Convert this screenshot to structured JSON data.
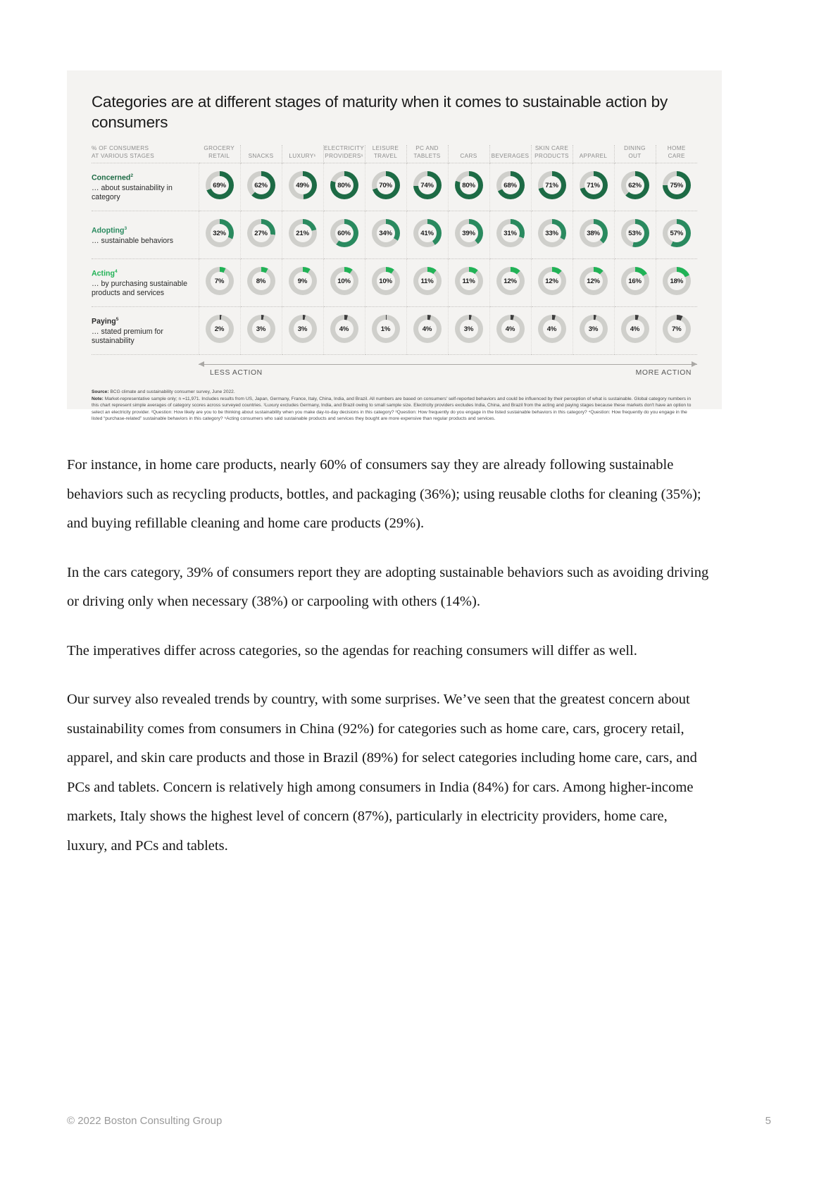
{
  "exhibit": {
    "title": "Categories are at different stages of maturity when it comes to sustainable action by consumers",
    "corner_header_line1": "% OF CONSUMERS",
    "corner_header_line2": "AT VARIOUS STAGES",
    "axis_left": "LESS ACTION",
    "axis_right": "MORE ACTION",
    "source_label": "Source:",
    "source_text": "BCG climate and sustainability consumer survey, June 2022.",
    "note_label": "Note:",
    "note_text": "Market-representative sample only; n =11,971. Includes results from US, Japan, Germany, France, Italy, China, India, and Brazil. All numbers are based on consumers' self-reported behaviors and could be influenced by their perception of what is sustainable. Global category numbers in this chart represent simple averages of category scores across surveyed countries. ¹Luxury excludes Germany, India, and Brazil owing to small sample size. Electricity providers excludes India, China, and Brazil from the acting and paying stages because these markets don't have an option to select an electricity provider. ²Question: How likely are you to be thinking about sustainability when you make day-to-day decisions in this category? ³Question: How frequently do you engage in the listed sustainable behaviors in this category? ⁴Question: How frequently do you engage in the listed “purchase-related” sustainable behaviors in this category? ⁵Acting consumers who said sustainable products and services they bought are more expensive than regular products and services."
  },
  "chart_data": {
    "type": "heatmap",
    "title": "Categories are at different stages of maturity when it comes to sustainable action by consumers",
    "unit": "%",
    "categories": [
      {
        "line1": "GROCERY",
        "line2": "RETAIL"
      },
      {
        "line1": "",
        "line2": "SNACKS"
      },
      {
        "line1": "",
        "line2": "LUXURY¹"
      },
      {
        "line1": "ELECTRICITY",
        "line2": "PROVIDERS¹"
      },
      {
        "line1": "LEISURE",
        "line2": "TRAVEL"
      },
      {
        "line1": "PC AND",
        "line2": "TABLETS"
      },
      {
        "line1": "",
        "line2": "CARS"
      },
      {
        "line1": "",
        "line2": "BEVERAGES"
      },
      {
        "line1": "SKIN CARE",
        "line2": "PRODUCTS"
      },
      {
        "line1": "",
        "line2": "APPAREL"
      },
      {
        "line1": "DINING",
        "line2": "OUT"
      },
      {
        "line1": "HOME",
        "line2": "CARE"
      }
    ],
    "series": [
      {
        "name": "Concerned",
        "sup": "2",
        "desc": "… about sustainability in category",
        "color": "#1d6b45",
        "values": [
          69,
          62,
          49,
          80,
          70,
          74,
          80,
          68,
          71,
          71,
          62,
          75
        ]
      },
      {
        "name": "Adopting",
        "sup": "3",
        "desc": "… sustainable behaviors",
        "color": "#2a8a5f",
        "values": [
          32,
          27,
          21,
          60,
          34,
          41,
          39,
          31,
          33,
          38,
          53,
          57
        ]
      },
      {
        "name": "Acting",
        "sup": "4",
        "desc": "… by purchasing sustainable products and services",
        "color": "#21b256",
        "values": [
          7,
          8,
          9,
          10,
          10,
          11,
          11,
          12,
          12,
          12,
          16,
          18
        ]
      },
      {
        "name": "Paying",
        "sup": "5",
        "desc": "… stated premium for sustainability",
        "color": "#3d3d3d",
        "values": [
          2,
          3,
          3,
          4,
          1,
          4,
          3,
          4,
          4,
          3,
          4,
          7
        ]
      }
    ],
    "track_color": "#cfcfcb",
    "xlabel_left": "LESS ACTION",
    "xlabel_right": "MORE ACTION"
  },
  "body": {
    "paragraphs": [
      "For instance, in home care products, nearly 60% of consumers say they are already following sustainable behaviors such as recycling products, bottles, and packaging (36%); using reusable cloths for cleaning (35%); and buying refillable cleaning and home care products (29%).",
      "In the cars category, 39% of consumers report they are adopting sustainable behaviors such as avoiding driving or driving only when necessary (38%) or carpooling with others (14%).",
      "The imperatives differ across categories, so the agendas for reaching consumers will differ as well.",
      "Our survey also revealed trends by country, with some surprises. We’ve seen that the greatest concern about sustainability comes from consumers in China (92%) for categories such as home care, cars, grocery retail, apparel, and skin care products and those in Brazil (89%) for select categories including home care, cars, and PCs and tablets. Concern is relatively high among consumers in India (84%) for cars. Among higher-income markets, Italy shows the highest level of concern (87%), particularly in electricity providers, home care, luxury, and PCs and tablets."
    ]
  },
  "footer": {
    "copyright": "© 2022 Boston Consulting Group",
    "page_number": "5"
  }
}
